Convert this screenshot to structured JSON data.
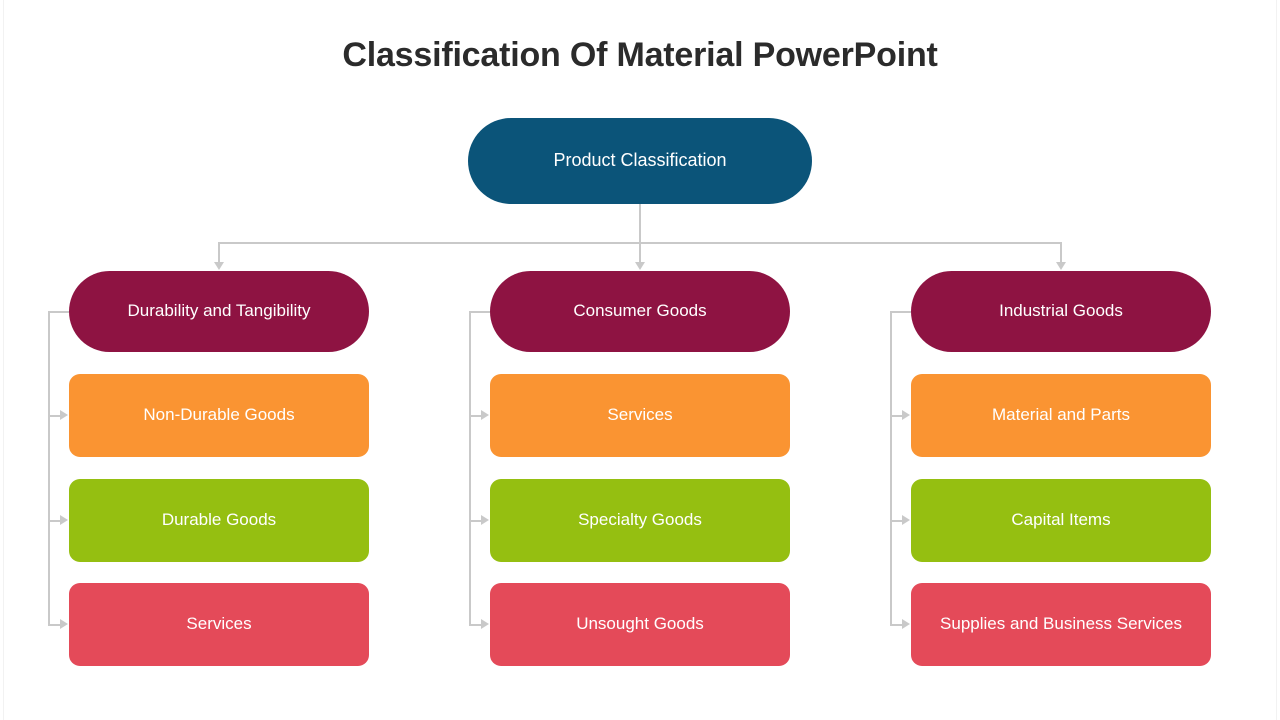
{
  "page_title": "Classification Of Material PowerPoint",
  "colors": {
    "background": "#ffffff",
    "title_text": "#2b2b2b",
    "root": "#0b5479",
    "header": "#8e1342",
    "leaf_orange": "#fa9432",
    "leaf_green": "#95bf11",
    "leaf_red": "#e44a59",
    "connector": "#c9c9c9",
    "node_text": "#ffffff"
  },
  "diagram": {
    "root": {
      "label": "Product Classification"
    },
    "branches": [
      {
        "header": "Durability and Tangibility",
        "items": [
          {
            "label": "Non-Durable Goods",
            "color_key": "leaf_orange"
          },
          {
            "label": "Durable Goods",
            "color_key": "leaf_green"
          },
          {
            "label": "Services",
            "color_key": "leaf_red"
          }
        ]
      },
      {
        "header": "Consumer Goods",
        "items": [
          {
            "label": "Services",
            "color_key": "leaf_orange"
          },
          {
            "label": "Specialty Goods",
            "color_key": "leaf_green"
          },
          {
            "label": "Unsought Goods",
            "color_key": "leaf_red"
          }
        ]
      },
      {
        "header": "Industrial Goods",
        "items": [
          {
            "label": "Material and Parts",
            "color_key": "leaf_orange"
          },
          {
            "label": "Capital Items",
            "color_key": "leaf_green"
          },
          {
            "label": "Supplies and Business Services",
            "color_key": "leaf_red"
          }
        ]
      }
    ]
  }
}
